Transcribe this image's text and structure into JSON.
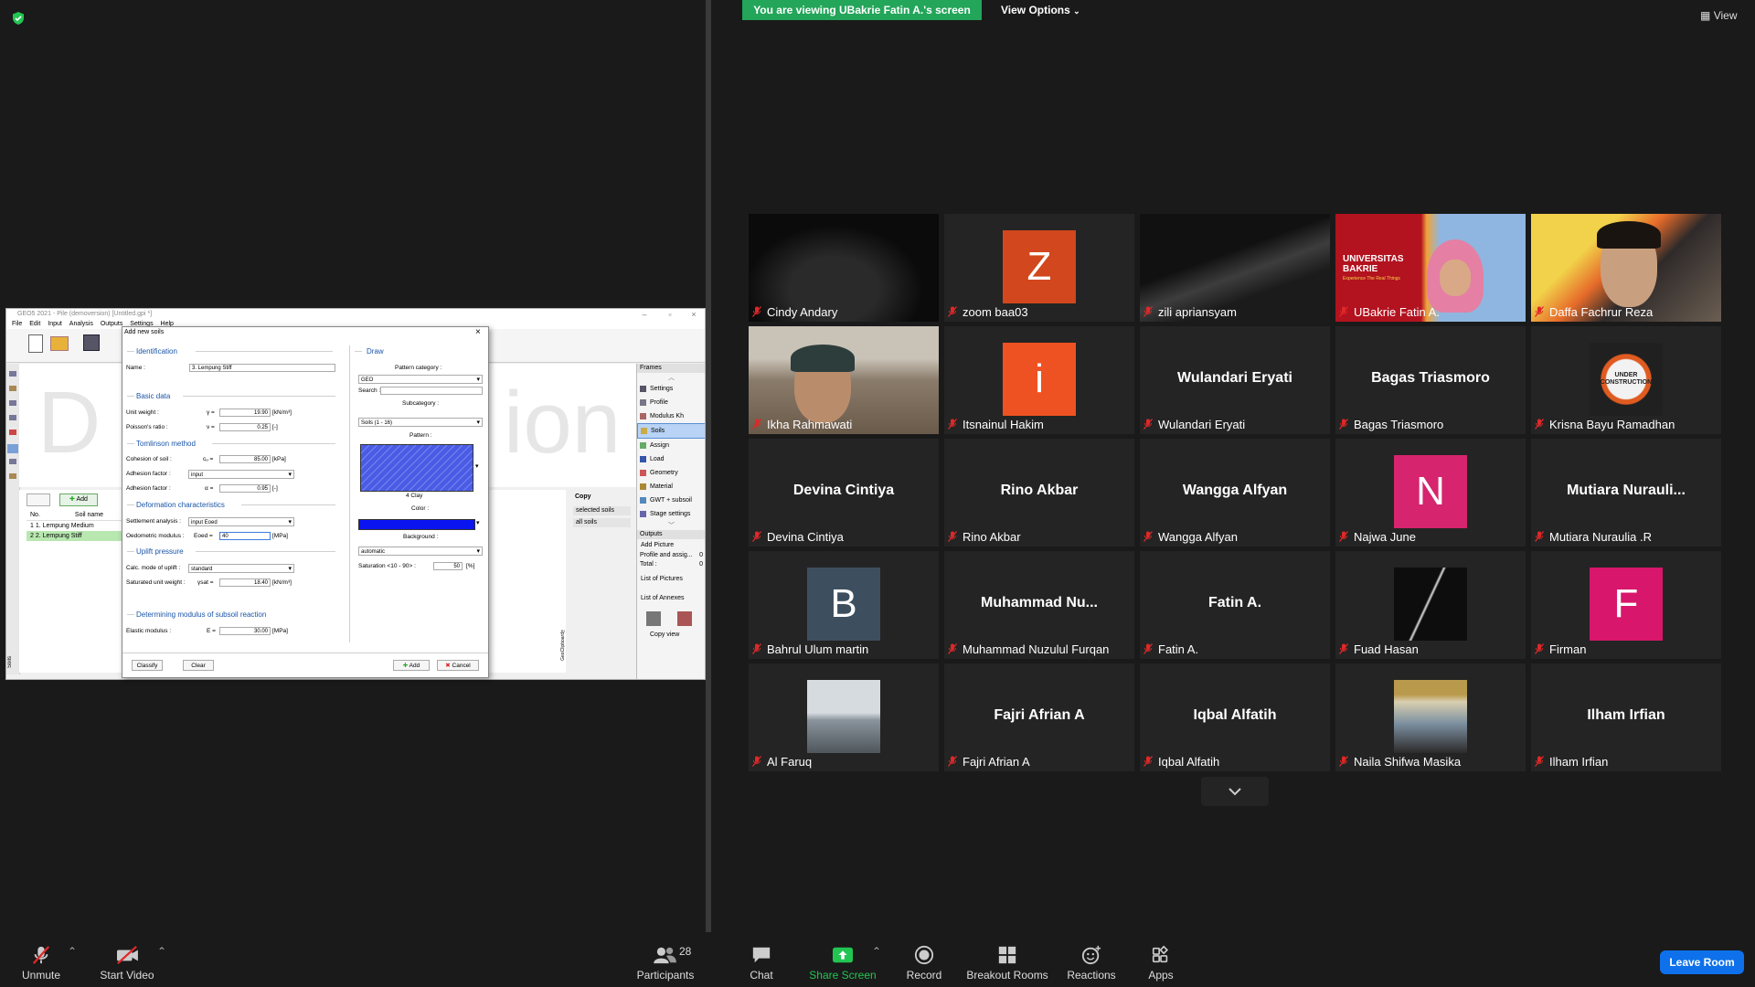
{
  "banner": {
    "viewing": "You are viewing UBakrie Fatin A.'s screen",
    "view_options": "View Options",
    "view": "View"
  },
  "geo": {
    "title": "GEO5 2021 - Pile (demoversion) [Untitled.gpi *]",
    "menu": [
      "File",
      "Edit",
      "Input",
      "Analysis",
      "Outputs",
      "Settings",
      "Help"
    ],
    "canvas_left": "D",
    "canvas_right": "ion",
    "table_headers": [
      "No.",
      "Soil name"
    ],
    "soils": [
      "1  1. Lempung Medium",
      "2  2. Lempung Stiff"
    ],
    "add_label": "Add",
    "frames_header": "Frames",
    "frames": [
      "Settings",
      "Profile",
      "Modulus Kh",
      "Soils",
      "Assign",
      "Load",
      "Geometry",
      "Material",
      "GWT + subsoil",
      "Stage settings"
    ],
    "outputs_header": "Outputs",
    "add_picture": "Add Picture",
    "profile_assign": "Profile and assig...",
    "profile_assign_val": "0",
    "total": "Total :",
    "total_val": "0",
    "list_pictures": "List of Pictures",
    "list_annexes": "List of Annexes",
    "copy_view": "Copy view",
    "copy": "Copy",
    "selected_soils": "selected soils",
    "all_soils": "all soils",
    "geoclipboard": "GeoClipboard™",
    "soils_side": "Soils"
  },
  "dialog": {
    "title": "Add new soils",
    "identification": "Identification",
    "name_label": "Name :",
    "name_value": "3. Lempung Stiff",
    "basic_data": "Basic data",
    "unit_weight": "Unit weight :",
    "unit_weight_sym": "γ =",
    "unit_weight_val": "19.90",
    "unit_weight_unit": "[kN/m³]",
    "poisson": "Poisson's ratio :",
    "poisson_sym": "ν =",
    "poisson_val": "0.25",
    "poisson_unit": "[-]",
    "tomlinson": "Tomlinson method",
    "cohesion": "Cohesion of soil :",
    "cohesion_sym": "cᵤ =",
    "cohesion_val": "85.00",
    "cohesion_unit": "[kPa]",
    "adhesion1": "Adhesion factor :",
    "adhesion1_val": "input",
    "adhesion2": "Adhesion factor :",
    "adhesion2_sym": "α =",
    "adhesion2_val": "0.95",
    "adhesion2_unit": "[-]",
    "deformation": "Deformation characteristics",
    "settlement": "Settlement analysis :",
    "settlement_val": "input Eoed",
    "oedometric": "Oedometric modulus :",
    "oedometric_sym": "Eoed =",
    "oedometric_val": "40",
    "oedometric_unit": "[MPa]",
    "uplift": "Uplift pressure",
    "calc_mode": "Calc. mode of uplift :",
    "calc_mode_val": "standard",
    "saturated": "Saturated unit weight :",
    "saturated_sym": "γsat =",
    "saturated_val": "18.40",
    "saturated_unit": "[kN/m³]",
    "subsoil": "Determining modulus of subsoil reaction",
    "elastic": "Elastic modulus :",
    "elastic_sym": "E =",
    "elastic_val": "30.00",
    "elastic_unit": "[MPa]",
    "draw": "Draw",
    "pattern_category": "Pattern category :",
    "pattern_category_val": "GEO",
    "search": "Search :",
    "subcategory": "Subcategory :",
    "subcategory_val": "Soils (1 - 16)",
    "pattern": "Pattern :",
    "pattern_name": "4 Clay",
    "color": "Color :",
    "background": "Background :",
    "background_val": "automatic",
    "saturation": "Saturation <10 - 90> :",
    "saturation_val": "50",
    "saturation_unit": "[%]",
    "classify": "Classify",
    "clear": "Clear",
    "add": "Add",
    "cancel": "Cancel"
  },
  "participants": [
    {
      "name": "Cindy Andary",
      "type": "video"
    },
    {
      "name": "zoom baa03",
      "type": "avatar",
      "letter": "Z",
      "color": "#d2471d"
    },
    {
      "name": "zili apriansyam",
      "type": "video"
    },
    {
      "name": "UBakrie Fatin A.",
      "type": "video",
      "speaker": true
    },
    {
      "name": "Daffa Fachrur Reza",
      "type": "video"
    },
    {
      "name": "Ikha Rahmawati",
      "type": "video"
    },
    {
      "name": "Itsnainul Hakim",
      "type": "avatar",
      "letter": "i",
      "color": "#ef5222"
    },
    {
      "name": "Wulandari Eryati",
      "type": "name",
      "center": "Wulandari Eryati"
    },
    {
      "name": "Bagas Triasmoro",
      "type": "name",
      "center": "Bagas Triasmoro"
    },
    {
      "name": "Krisna Bayu Ramadhan",
      "type": "picture"
    },
    {
      "name": "Devina Cintiya",
      "type": "name",
      "center": "Devina Cintiya"
    },
    {
      "name": "Rino Akbar",
      "type": "name",
      "center": "Rino Akbar"
    },
    {
      "name": "Wangga Alfyan",
      "type": "name",
      "center": "Wangga Alfyan"
    },
    {
      "name": "Najwa June",
      "type": "avatar",
      "letter": "N",
      "color": "#d6246e"
    },
    {
      "name": "Mutiara Nuraulia .R",
      "type": "name",
      "center": "Mutiara  Nurauli..."
    },
    {
      "name": "Bahrul Ulum martin",
      "type": "avatar",
      "letter": "B",
      "color": "#3d4f5e"
    },
    {
      "name": "Muhammad Nuzulul Furqan",
      "type": "name",
      "center": "Muhammad  Nu..."
    },
    {
      "name": "Fatin A.",
      "type": "name",
      "center": "Fatin A."
    },
    {
      "name": "Fuad Hasan",
      "type": "picture"
    },
    {
      "name": "Firman",
      "type": "avatar",
      "letter": "F",
      "color": "#d8166b"
    },
    {
      "name": "Al Faruq",
      "type": "picture"
    },
    {
      "name": "Fajri Afrian A",
      "type": "name",
      "center": "Fajri Afrian A"
    },
    {
      "name": "Iqbal Alfatih",
      "type": "name",
      "center": "Iqbal Alfatih"
    },
    {
      "name": "Naila Shifwa Masika",
      "type": "picture"
    },
    {
      "name": "Ilham Irfian",
      "type": "name",
      "center": "Ilham Irfian"
    }
  ],
  "speaker_banner": {
    "line1": "UNIVERSITAS",
    "line2": "BAKRIE",
    "line3": "Experience The Real Things"
  },
  "krisna_badge": "UNDER CONSTRUCTION",
  "toolbar": {
    "unmute": "Unmute",
    "start_video": "Start Video",
    "participants": "Participants",
    "participants_count": "28",
    "chat": "Chat",
    "share_screen": "Share Screen",
    "record": "Record",
    "breakout": "Breakout Rooms",
    "reactions": "Reactions",
    "apps": "Apps",
    "leave": "Leave Room"
  },
  "colors": {
    "green_banner": "#23a55a",
    "leave": "#0e71eb",
    "speaker_outline": "#f5d742",
    "share_green": "#23c552",
    "mute_red": "#e02828"
  }
}
